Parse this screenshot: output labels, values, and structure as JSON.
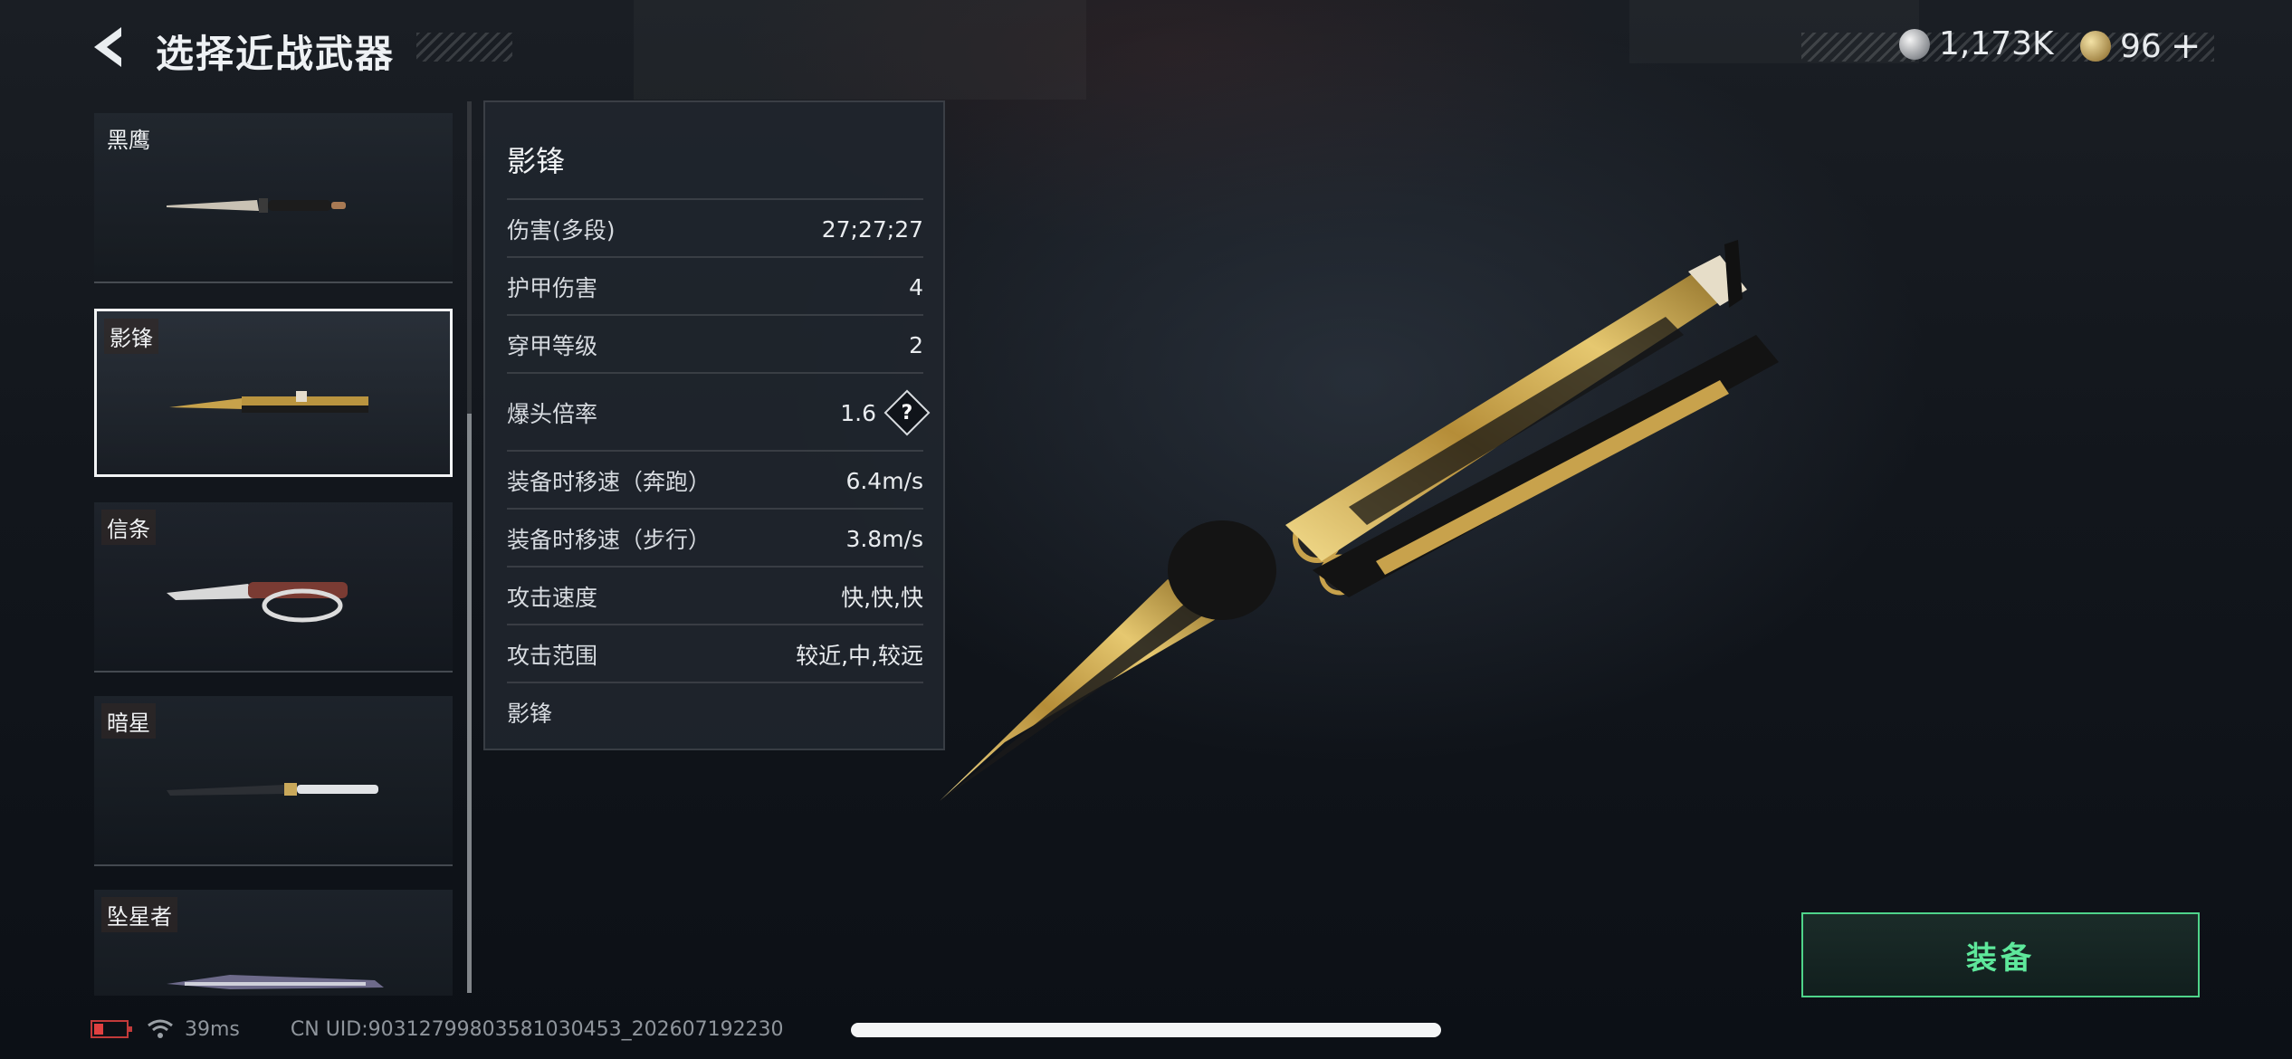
{
  "header": {
    "title": "选择近战武器"
  },
  "currency": {
    "silver_value": "1,173K",
    "gold_value": "96",
    "gold_add": "+"
  },
  "weapon_list": [
    {
      "name": "黑鹰"
    },
    {
      "name": "影锋"
    },
    {
      "name": "信条"
    },
    {
      "name": "暗星"
    },
    {
      "name": "坠星者"
    }
  ],
  "stats_panel": {
    "title": "影锋",
    "rows": [
      {
        "label": "伤害(多段)",
        "value": "27;27;27"
      },
      {
        "label": "护甲伤害",
        "value": "4"
      },
      {
        "label": "穿甲等级",
        "value": "2"
      },
      {
        "label": "爆头倍率",
        "value": "1.6"
      },
      {
        "label": "装备时移速（奔跑）",
        "value": "6.4m/s"
      },
      {
        "label": "装备时移速（步行）",
        "value": "3.8m/s"
      },
      {
        "label": "攻击速度",
        "value": "快,快,快"
      },
      {
        "label": "攻击范围",
        "value": "较近,中,较远"
      }
    ],
    "footer": "影锋",
    "help_icon_label": "?"
  },
  "equip_button": {
    "label": "装备"
  },
  "status_bar": {
    "ping": "39ms",
    "uid": "CN UID:903127998035810304​53_202607192230"
  },
  "icons": {
    "back": "chevron-left-icon",
    "silver_coin": "silver-coin-icon",
    "gold_coin": "gold-coin-icon",
    "help": "question-icon",
    "battery": "battery-low-icon",
    "wifi": "wifi-icon"
  },
  "colors": {
    "equip_accent": "#5ee89b",
    "selected_border": "#f2f4f5",
    "battery_low": "#e04040"
  }
}
